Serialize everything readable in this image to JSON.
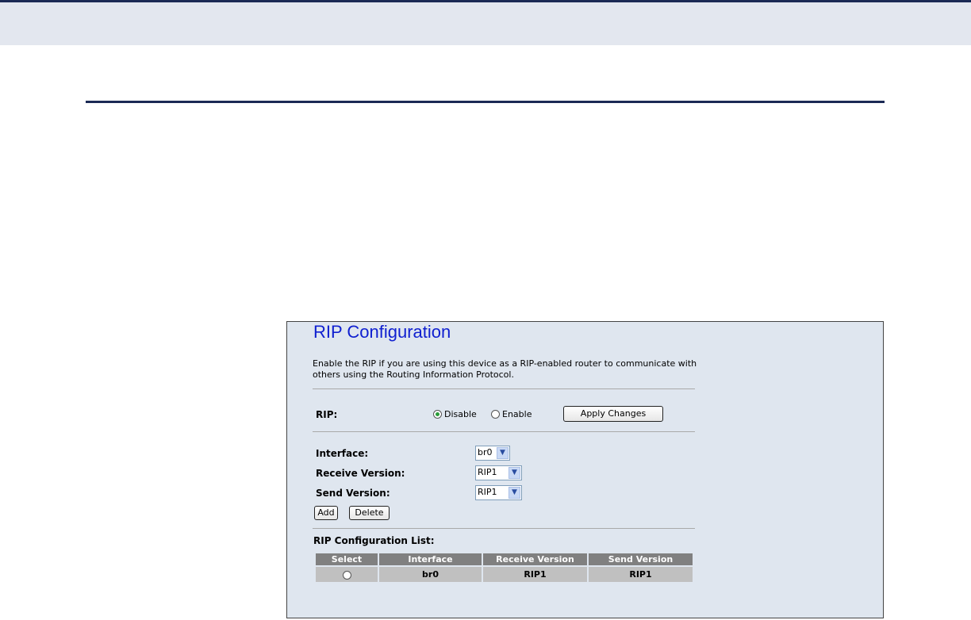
{
  "rip_page": {
    "title": "RIP Configuration",
    "description": "Enable the RIP if you are using this device as a RIP-enabled router to communicate with others using the Routing Information Protocol.",
    "rip": {
      "label": "RIP:",
      "options": [
        "Disable",
        "Enable"
      ],
      "selected": "Disable",
      "apply_label": "Apply Changes"
    },
    "interface": {
      "label": "Interface:",
      "value": "br0"
    },
    "receive_version": {
      "label": "Receive Version:",
      "value": "RIP1"
    },
    "send_version": {
      "label": "Send Version:",
      "value": "RIP1"
    },
    "add_label": "Add",
    "delete_label": "Delete",
    "list": {
      "title": "RIP Configuration List:",
      "headers": [
        "Select",
        "Interface",
        "Receive Version",
        "Send Version"
      ],
      "rows": [
        {
          "interface": "br0",
          "receive_version": "RIP1",
          "send_version": "RIP1"
        }
      ]
    }
  },
  "colors": {
    "title": "#1020d0",
    "frame_background": "#dfe6ef",
    "table_header": "#808080",
    "table_cell": "#c0c0c0",
    "selected_radio": "#2a9c3a",
    "banner": "#e3e7ef",
    "rule": "#1b2a55"
  }
}
